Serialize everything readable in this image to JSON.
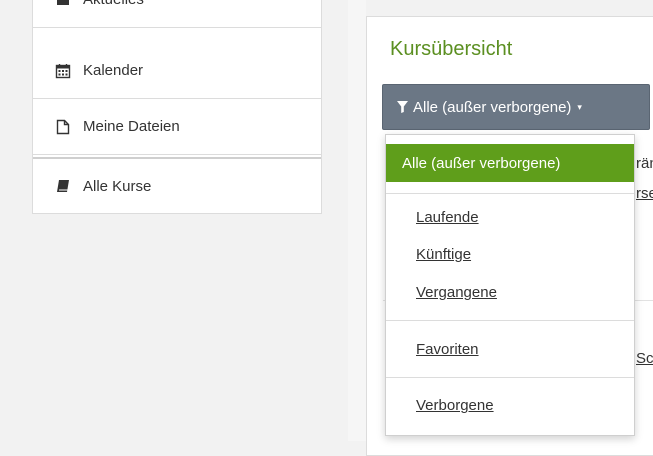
{
  "sidebar": {
    "items": [
      {
        "label": "Aktuelles",
        "icon": "newspaper-icon"
      },
      {
        "label": "Kalender",
        "icon": "calendar-icon"
      },
      {
        "label": "Meine Dateien",
        "icon": "file-icon"
      },
      {
        "label": "Alle Kurse",
        "icon": "book-icon"
      }
    ]
  },
  "main": {
    "title": "Kursübersicht",
    "filter_button": {
      "label": "Alle (außer verborgene)",
      "icon": "filter-icon",
      "caret": "▾"
    },
    "peek": [
      "rän",
      "rse",
      "Sc"
    ]
  },
  "dropdown": {
    "active": "Alle (außer verborgene)",
    "group1": [
      "Laufende",
      "Künftige",
      "Vergangene"
    ],
    "group2": [
      "Favoriten"
    ],
    "group3": [
      "Verborgene"
    ]
  },
  "colors": {
    "accent_green": "#5f9e1b",
    "title_green": "#5b8f21",
    "button_grey": "#6b7785"
  }
}
